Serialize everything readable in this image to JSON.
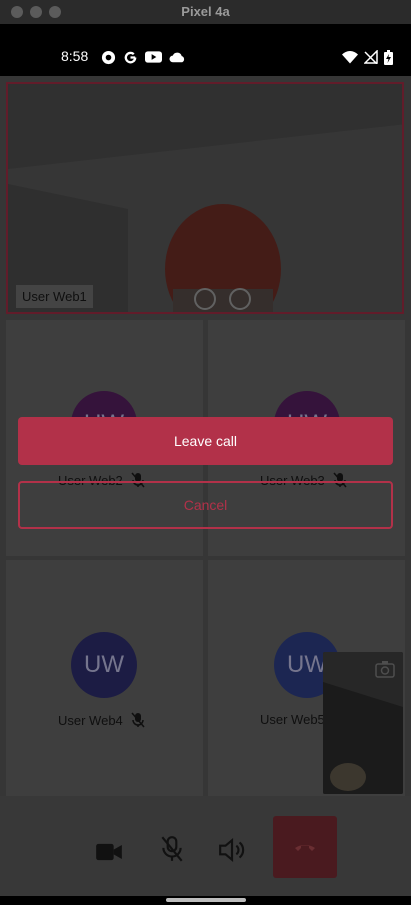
{
  "window": {
    "title": "Pixel 4a"
  },
  "status_bar": {
    "time": "8:58",
    "left_icons": [
      "pocket-casts-icon",
      "google-icon",
      "youtube-icon",
      "cloud-icon"
    ],
    "right_icons": [
      "wifi-icon",
      "signal-off-icon",
      "battery-charging-icon"
    ]
  },
  "participants": [
    {
      "name": "User Web1",
      "video": true
    },
    {
      "name": "User Web2",
      "initials": "UW",
      "muted": true
    },
    {
      "name": "User Web3",
      "initials": "UW",
      "muted": true
    },
    {
      "name": "User Web4",
      "initials": "UW",
      "muted": true
    },
    {
      "name": "User Web5",
      "initials": "UW",
      "muted": false
    }
  ],
  "dialog": {
    "leave_label": "Leave call",
    "cancel_label": "Cancel"
  },
  "controls": [
    "camera-icon",
    "mic-off-icon",
    "speaker-icon",
    "end-call-icon"
  ],
  "colors": {
    "accent": "#b23149",
    "background": "#3b3b3b",
    "avatar": "#1f1f4a"
  }
}
